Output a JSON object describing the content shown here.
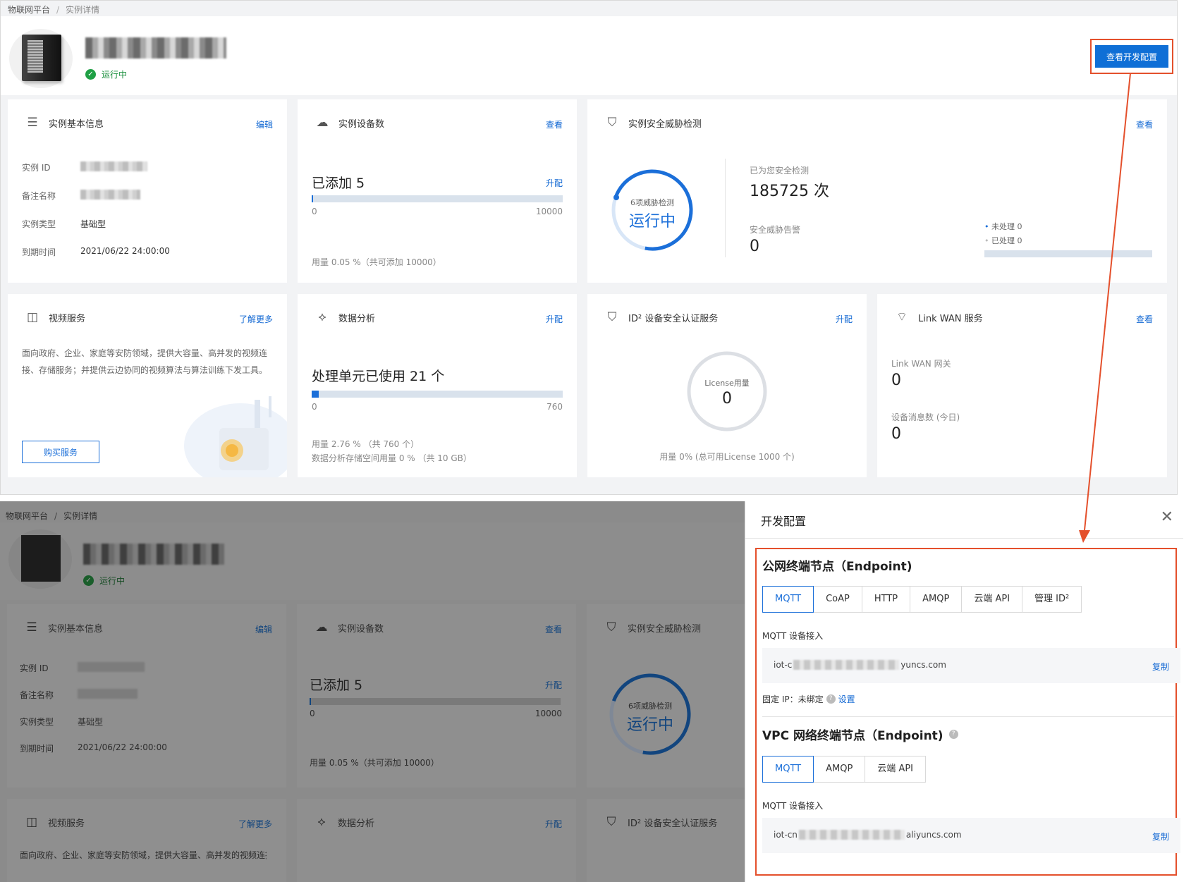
{
  "breadcrumb": {
    "root": "物联网平台",
    "separator": "/",
    "current": "实例详情"
  },
  "instance": {
    "status": "运行中"
  },
  "header": {
    "dev_config_button": "查看开发配置"
  },
  "basic_info": {
    "title": "实例基本信息",
    "link": "编辑",
    "rows": [
      {
        "label": "实例 ID",
        "value": ""
      },
      {
        "label": "备注名称",
        "value": ""
      },
      {
        "label": "实例类型",
        "value": "基础型"
      },
      {
        "label": "到期时间",
        "value": "2021/06/22 24:00:00"
      }
    ]
  },
  "devices": {
    "title": "实例设备数",
    "link": "查看",
    "added": "已添加 5",
    "upgrade": "升配",
    "min": "0",
    "max": "10000",
    "usage": "用量 0.05 %（共可添加 10000）",
    "fill_fraction": 0.0005
  },
  "security": {
    "title": "实例安全威胁检测",
    "link": "查看",
    "ring_caption": "6项威胁检测",
    "ring_status": "运行中",
    "checked_label": "已为您安全检测",
    "checked_value": "185725 次",
    "alerts_label": "安全威胁告警",
    "alerts_value": "0",
    "unhandled": "未处理  0",
    "handled": "已处理  0"
  },
  "video": {
    "title": "视频服务",
    "link": "了解更多",
    "desc": "面向政府、企业、家庭等安防领域，提供大容量、高并发的视频连接、存储服务；并提供云边协同的视频算法与算法训练下发工具。",
    "buy": "购买服务"
  },
  "analytics": {
    "title": "数据分析",
    "link": "升配",
    "used": "处理单元已使用 21 个",
    "min": "0",
    "max": "760",
    "usage1": "用量 2.76 %  （共 760 个）",
    "usage2": "数据分析存储空间用量 0 %  （共 10 GB）",
    "fill_fraction": 0.0276
  },
  "id2": {
    "title": "ID² 设备安全认证服务",
    "link": "升配",
    "ring_caption": "License用量",
    "ring_value": "0",
    "usage": "用量 0% (总可用License 1000 个)"
  },
  "linkwan": {
    "title": "Link WAN 服务",
    "link": "查看",
    "gateway_label": "Link WAN 网关",
    "gateway_value": "0",
    "msg_label": "设备消息数 (今日)",
    "msg_value": "0"
  },
  "drawer": {
    "title": "开发配置",
    "close": "✕",
    "public": {
      "title": "公网终端节点（Endpoint)",
      "tabs": [
        "MQTT",
        "CoAP",
        "HTTP",
        "AMQP",
        "云端 API",
        "管理 ID²"
      ],
      "field_label": "MQTT 设备接入",
      "endpoint_prefix": "iot-c",
      "endpoint_suffix": "yuncs.com",
      "copy": "复制",
      "fixed_ip": "固定 IP：未绑定",
      "set": "设置"
    },
    "vpc": {
      "title": "VPC 网络终端节点（Endpoint)",
      "tabs": [
        "MQTT",
        "AMQP",
        "云端 API"
      ],
      "field_label": "MQTT 设备接入",
      "endpoint_prefix": "iot-cn",
      "endpoint_suffix": "aliyuncs.com",
      "copy": "复制"
    }
  },
  "colors": {
    "accent": "#1b6fd9",
    "highlight": "#e4502c",
    "success": "#1fa045"
  }
}
